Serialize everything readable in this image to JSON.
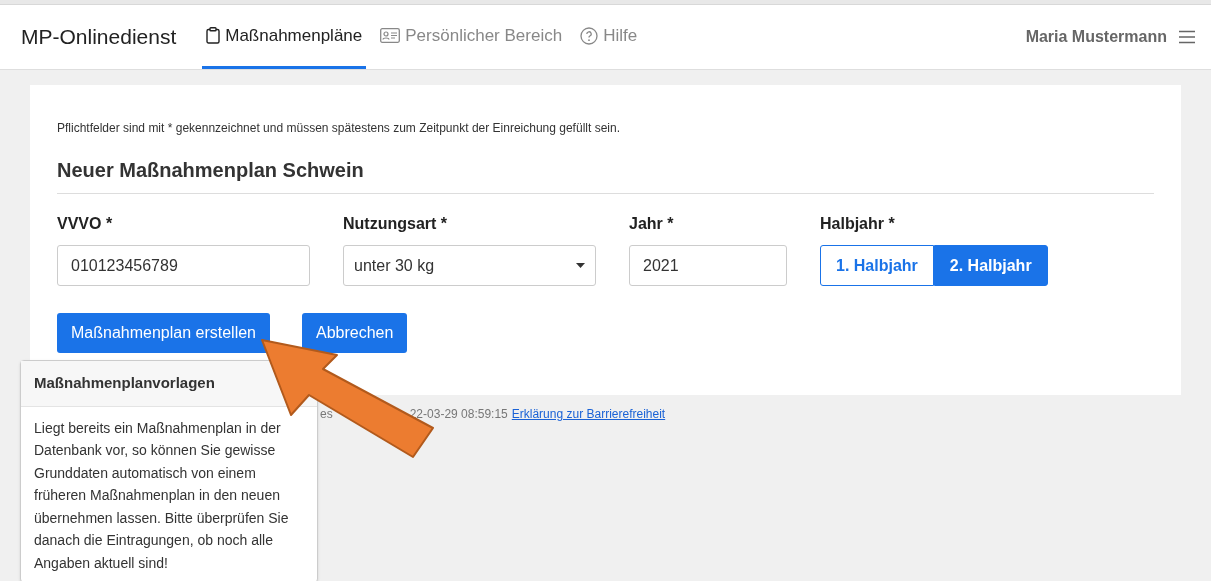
{
  "brand": "MP-Onlinedienst",
  "tabs": [
    {
      "label": "Maßnahmenpläne",
      "selected": true
    },
    {
      "label": "Persönlicher Bereich",
      "selected": false
    },
    {
      "label": "Hilfe",
      "selected": false
    }
  ],
  "user": "Maria Mustermann",
  "note": "Pflichtfelder sind mit * gekennzeichnet und müssen spätestens zum Zeitpunkt der Einreichung gefüllt sein.",
  "form_title": "Neuer Maßnahmenplan Schwein",
  "fields": [
    {
      "label": "VVVO *",
      "kind": "text",
      "value": "010123456789"
    },
    {
      "label": "Nutzungsart *",
      "kind": "select",
      "value": "unter 30 kg"
    },
    {
      "label": "Jahr *",
      "kind": "text",
      "value": "2021"
    },
    {
      "label": "Halbjahr *",
      "kind": "segmented",
      "options": [
        {
          "label": "1. Halbjahr",
          "selected": false
        },
        {
          "label": "2. Halbjahr",
          "selected": true
        }
      ]
    }
  ],
  "buttons": [
    "Maßnahmenplan erstellen",
    "Abbrechen"
  ],
  "footer": {
    "fragment": "es",
    "timestamp": "22-03-29 08:59:15",
    "link": "Erklärung zur Barrierefreiheit"
  },
  "popover": {
    "title": "Maßnahmenplanvorlagen",
    "body": "Liegt bereits ein Maßnahmenplan in der Datenbank vor, so können Sie gewisse Grunddaten automatisch von einem früheren Maßnahmenplan in den neuen übernehmen lassen. Bitte überprüfen Sie danach die Eintragungen, ob noch alle Angaben aktuell sind!"
  }
}
